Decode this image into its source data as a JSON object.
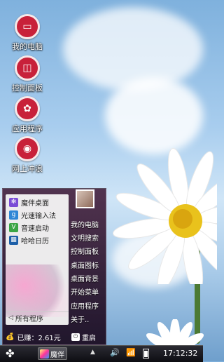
{
  "desktop": {
    "icons": [
      {
        "label": "我的电脑",
        "icon": "computer-icon"
      },
      {
        "label": "控制面板",
        "icon": "control-panel-icon"
      },
      {
        "label": "应用程序",
        "icon": "apps-icon"
      },
      {
        "label": "网上冲浪",
        "icon": "browser-icon"
      }
    ]
  },
  "start_menu": {
    "apps": [
      {
        "label": "魔伴桌面",
        "icon": "moban-desktop-icon",
        "color": "#7a4bd6"
      },
      {
        "label": "光速输入法",
        "icon": "input-method-icon",
        "color": "#2f86d6"
      },
      {
        "label": "音速启动",
        "icon": "launcher-icon",
        "color": "#3aa545"
      },
      {
        "label": "哈哈日历",
        "icon": "calendar-icon",
        "color": "#1d5fa8"
      }
    ],
    "all_programs": "所有程序",
    "right_items": [
      "我的电脑",
      "文明搜索",
      "控制面板",
      "桌面图标",
      "桌面背景",
      "开始菜单",
      "应用程序",
      "关于.."
    ],
    "earned": "已赚：2.61元",
    "restart": "重启"
  },
  "taskbar": {
    "task_label": "魔伴",
    "clock": "17:12:32"
  },
  "colors": {
    "desktop_icon_red": "#c8213a",
    "menu_bg": "#2a1224"
  }
}
